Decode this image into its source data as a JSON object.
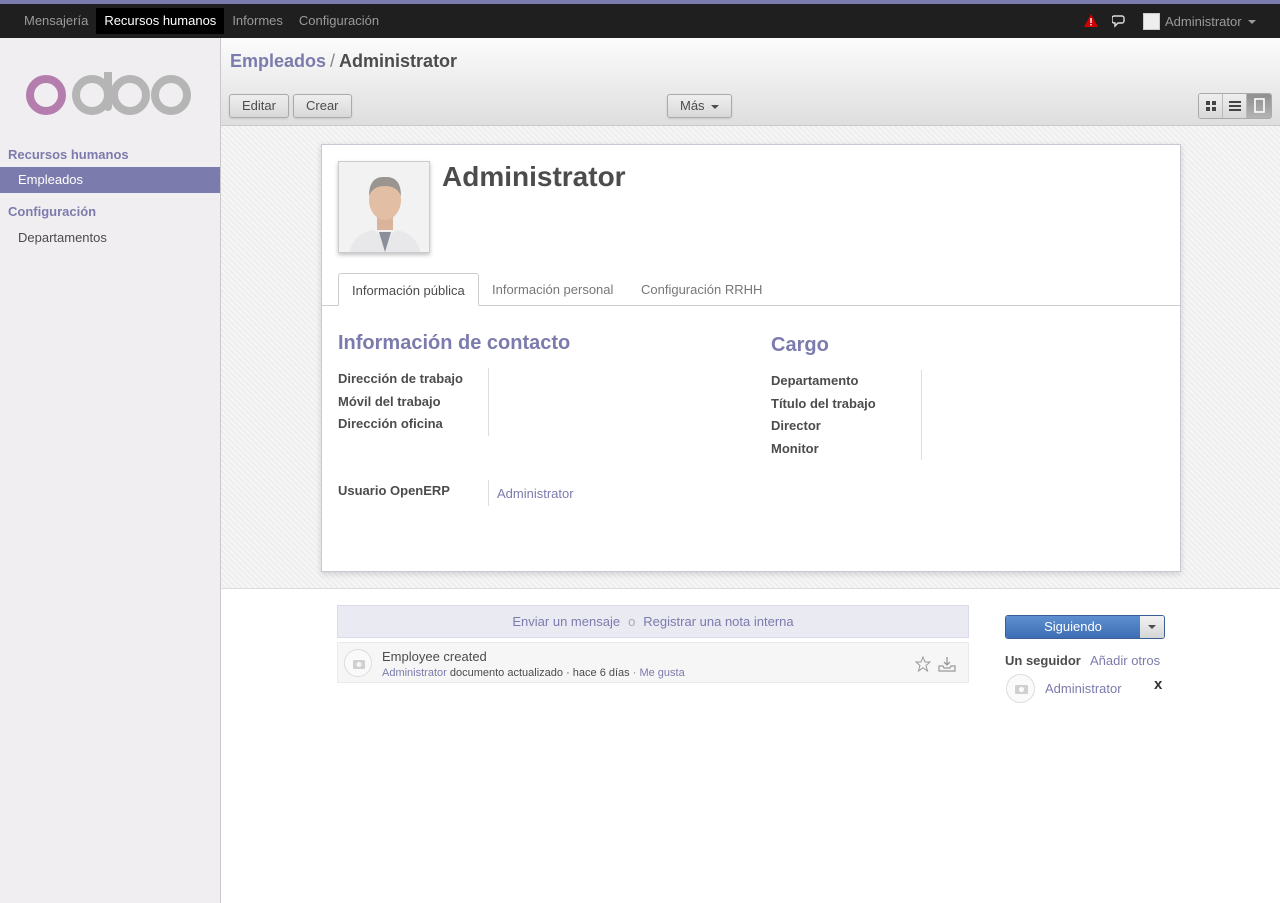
{
  "topbar": {
    "menu": [
      "Mensajería",
      "Recursos humanos",
      "Informes",
      "Configuración"
    ],
    "active_index": 1,
    "user": "Administrator"
  },
  "sidebar": {
    "sections": [
      {
        "title": "Recursos humanos",
        "items": [
          "Empleados"
        ]
      },
      {
        "title": "Configuración",
        "items": [
          "Departamentos"
        ]
      }
    ],
    "active_item": "Empleados"
  },
  "header": {
    "breadcrumb_parent": "Empleados",
    "breadcrumb_sep": "/",
    "breadcrumb_current": "Administrator",
    "edit_label": "Editar",
    "create_label": "Crear",
    "more_label": "Más",
    "active_view": "form"
  },
  "form": {
    "name": "Administrator",
    "tabs": [
      "Información pública",
      "Información personal",
      "Configuración RRHH"
    ],
    "active_tab": 0,
    "contact": {
      "title": "Información de contacto",
      "labels": [
        "Dirección de trabajo",
        "Móvil del trabajo",
        "Dirección oficina"
      ]
    },
    "position": {
      "title": "Cargo",
      "labels": [
        "Departamento",
        "Título del trabajo",
        "Director",
        "Monitor"
      ]
    },
    "user_label": "Usuario OpenERP",
    "user_value": "Administrator"
  },
  "chatter": {
    "send_message": "Enviar un mensaje",
    "separator": "o",
    "log_note": "Registrar una nota interna",
    "message": {
      "body": "Employee created",
      "author": "Administrator",
      "action": "documento actualizado",
      "time": "hace 6 días",
      "like": "Me gusta"
    },
    "follow_label": "Siguiendo",
    "followers_count": "Un seguidor",
    "add_others": "Añadir otros",
    "followers": [
      "Administrator"
    ],
    "remove_label": "x"
  },
  "colors": {
    "accent": "#7c7bad",
    "topbar": "#1f1f1f",
    "follow_button": "#3d6eb4",
    "warning": "#d00000"
  }
}
